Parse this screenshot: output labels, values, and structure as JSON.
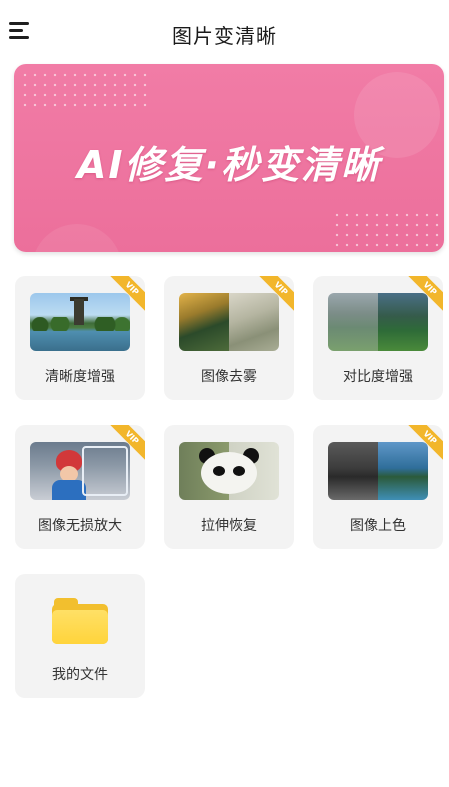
{
  "header": {
    "title": "图片变清晰",
    "menu_icon": "hamburger-menu-icon"
  },
  "banner": {
    "text": "AI修复·秒变清晰",
    "color": "#ef77a3"
  },
  "tools": [
    {
      "label": "清晰度增强",
      "vip": "VIP",
      "thumbnail": "lake-pagoda-photo"
    },
    {
      "label": "图像去雾",
      "vip": "VIP",
      "thumbnail": "foggy-forest-before-after"
    },
    {
      "label": "对比度增强",
      "vip": "VIP",
      "thumbnail": "mountain-valley-before-after"
    },
    {
      "label": "图像无损放大",
      "vip": "VIP",
      "thumbnail": "girl-red-hat-zoom"
    },
    {
      "label": "拉伸恢复",
      "vip": "",
      "thumbnail": "panda-before-after"
    },
    {
      "label": "图像上色",
      "vip": "VIP",
      "thumbnail": "grayscale-to-color-landscape"
    },
    {
      "label": "我的文件",
      "vip": "",
      "thumbnail": "folder-icon"
    }
  ],
  "colors": {
    "vip_badge": "#f2b62b",
    "tile_background": "#f3f3f3",
    "folder": "#ffd43b"
  }
}
